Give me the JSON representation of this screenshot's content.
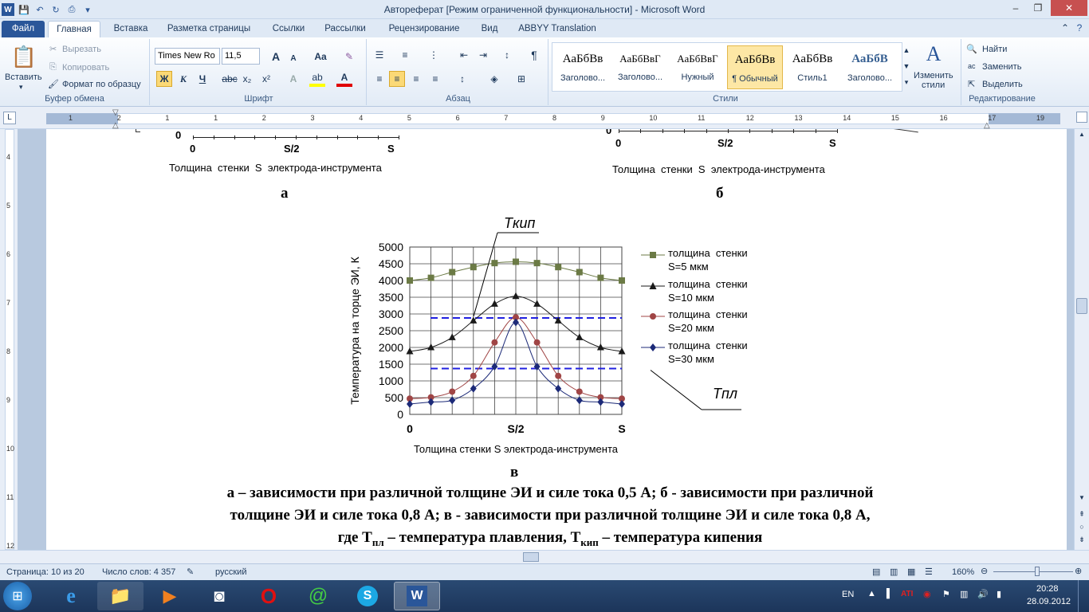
{
  "window": {
    "title": "Автореферат [Режим ограниченной функциональности]  -  Microsoft Word",
    "min": "–",
    "max": "❐",
    "close": "✕"
  },
  "tabs": [
    "Файл",
    "Главная",
    "Вставка",
    "Разметка страницы",
    "Ссылки",
    "Рассылки",
    "Рецензирование",
    "Вид",
    "ABBYY Translation"
  ],
  "ribbon": {
    "clipboard": {
      "label": "Буфер обмена",
      "paste": "Вставить",
      "cut": "Вырезать",
      "copy": "Копировать",
      "format_painter": "Формат по образцу"
    },
    "font": {
      "label": "Шрифт",
      "family": "Times New Ro",
      "size": "11,5",
      "bold": "Ж",
      "italic": "К",
      "underline": "Ч",
      "strike": "abc",
      "sub": "x₂",
      "sup": "x²",
      "case": "Aa",
      "grow": "A",
      "shrink": "A"
    },
    "paragraph": {
      "label": "Абзац",
      "pilcrow": "¶"
    },
    "styles": {
      "label": "Стили",
      "items": [
        {
          "sample": "АаБбВв",
          "name": "Заголово..."
        },
        {
          "sample": "АаБбВвГ",
          "name": "Заголово..."
        },
        {
          "sample": "АаБбВвГ",
          "name": "Нужный"
        },
        {
          "sample": "АаБбВв",
          "name": "¶ Обычный"
        },
        {
          "sample": "АаБбВв",
          "name": "Стиль1"
        },
        {
          "sample": "АаБбВ",
          "name": "Заголово..."
        }
      ],
      "change": "Изменить",
      "change2": "стили"
    },
    "editing": {
      "label": "Редактирование",
      "find": "Найти",
      "replace": "Заменить",
      "select": "Выделить"
    }
  },
  "ruler": {
    "marks": [
      "1",
      "2",
      "1",
      "1",
      "2",
      "3",
      "4",
      "5",
      "6",
      "7",
      "8",
      "9",
      "10",
      "11",
      "12",
      "13",
      "14",
      "15",
      "16",
      "17",
      "19"
    ]
  },
  "vruler": {
    "marks": [
      "4",
      "5",
      "6",
      "7",
      "8",
      "9",
      "10",
      "11",
      "12",
      "13"
    ]
  },
  "document": {
    "top_left": {
      "zero": "0",
      "x0": "0",
      "xmid": "S/2",
      "xs": "S",
      "xlabel": "Толщина  стенки  S  электрода-инструмента",
      "letter": "а"
    },
    "top_right": {
      "zero": "0",
      "x0": "0",
      "xmid": "S/2",
      "xs": "S",
      "xlabel": "Толщина  стенки  S  электрода-инструмента",
      "letter": "б"
    },
    "fig_letter": "в",
    "caption_lines": [
      "а – зависимости при различной толщине ЭИ и силе тока 0,5 А; б - зависимости при различной",
      "толщине ЭИ и силе тока 0,8 А; в - зависимости при различной толщине ЭИ и силе тока 0,8 А,",
      "где Т",
      "пл",
      " – температура плавления, Т",
      "кип",
      " – температура кипения"
    ]
  },
  "chart_data": {
    "type": "line",
    "title": "",
    "xlabel": "Толщина стенки S электрода-инструмента",
    "ylabel": "Температура на торце ЭИ, К",
    "xticks": [
      "0",
      "S/2",
      "S"
    ],
    "yticks": [
      "0",
      "500",
      "1000",
      "1500",
      "2000",
      "2500",
      "3000",
      "3500",
      "4000",
      "4500",
      "5000"
    ],
    "ylim": [
      0,
      5000
    ],
    "x": [
      0,
      1,
      2,
      3,
      4,
      5,
      6,
      7,
      8,
      9,
      10
    ],
    "series": [
      {
        "name": "толщина стенки S=5 мкм",
        "color": "#6b7a45",
        "marker": "square",
        "values": [
          4000,
          4080,
          4250,
          4400,
          4520,
          4560,
          4520,
          4400,
          4250,
          4080,
          4000
        ]
      },
      {
        "name": "толщина стенки S=10 мкм",
        "color": "#1a1a1a",
        "marker": "triangle",
        "values": [
          1880,
          2000,
          2300,
          2800,
          3300,
          3530,
          3300,
          2800,
          2300,
          2000,
          1880
        ]
      },
      {
        "name": "толщина стенки S=20 мкм",
        "color": "#a04545",
        "marker": "circle",
        "values": [
          470,
          510,
          680,
          1150,
          2150,
          2900,
          2150,
          1150,
          680,
          510,
          470
        ]
      },
      {
        "name": "толщина стенки S=30 мкм",
        "color": "#1c2a78",
        "marker": "diamond",
        "values": [
          310,
          370,
          420,
          770,
          1430,
          2750,
          1430,
          770,
          420,
          370,
          310
        ]
      }
    ],
    "hlines": [
      {
        "name": "Tкип",
        "value": 2880,
        "color": "#2020e0"
      },
      {
        "name": "Tпл",
        "value": 1370,
        "color": "#2020e0"
      }
    ],
    "annotations": [
      "Tкип",
      "Tпл"
    ],
    "legend": "right",
    "grid": true
  },
  "legend_lines": [
    [
      "толщина  стенки",
      "S=5 мкм"
    ],
    [
      "толщина  стенки",
      "S=10 мкм"
    ],
    [
      "толщина  стенки",
      "S=20 мкм"
    ],
    [
      "толщина  стенки",
      "S=30 мкм"
    ]
  ],
  "annot": {
    "tkip": "Tкип",
    "tpl": "Tпл"
  },
  "status": {
    "page": "Страница: 10 из 20",
    "words": "Число слов: 4 357",
    "lang": "русский",
    "zoom": "160%"
  },
  "taskbar": {
    "lang": "EN",
    "time": "20:28",
    "date": "28.09.2012"
  }
}
